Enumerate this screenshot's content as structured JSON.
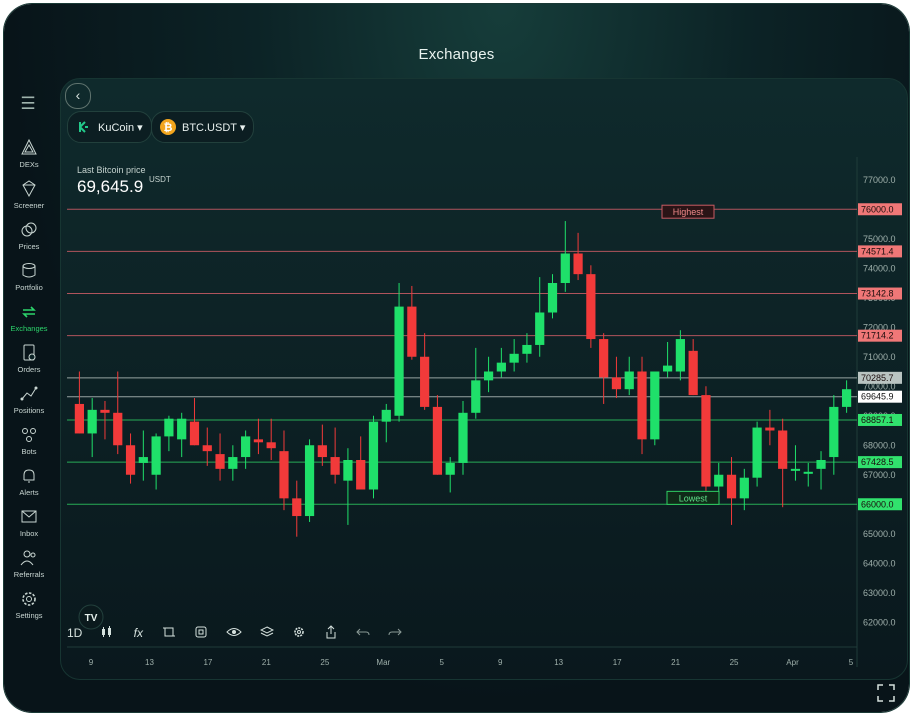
{
  "title": "Exchanges",
  "sidebar": {
    "items": [
      {
        "label": "DEXs",
        "icon": "dex-icon"
      },
      {
        "label": "Screener",
        "icon": "diamond-icon"
      },
      {
        "label": "Prices",
        "icon": "coin-icon"
      },
      {
        "label": "Portfolio",
        "icon": "portfolio-icon"
      },
      {
        "label": "Exchanges",
        "icon": "exchange-arrows-icon",
        "active": true
      },
      {
        "label": "Orders",
        "icon": "orders-icon"
      },
      {
        "label": "Positions",
        "icon": "positions-icon"
      },
      {
        "label": "Bots",
        "icon": "bots-icon"
      },
      {
        "label": "Alerts",
        "icon": "bell-icon"
      },
      {
        "label": "Inbox",
        "icon": "mail-icon"
      },
      {
        "label": "Referrals",
        "icon": "users-icon"
      },
      {
        "label": "Settings",
        "icon": "gear-icon"
      }
    ]
  },
  "selectors": {
    "exchange": "KuCoin ▾",
    "pair": "BTC.USDT ▾"
  },
  "price": {
    "label": "Last Bitcoin price",
    "value": "69,645.9",
    "unit": "USDT"
  },
  "toolbar": {
    "interval": "1D",
    "fx": "fx"
  },
  "colors": {
    "up": "#1fe06a",
    "down": "#f23a3a",
    "resistance": "#d9606a",
    "support": "#2fcf63",
    "current": "#b9c4c1"
  },
  "chart_data": {
    "type": "candlestick",
    "y_ticks": [
      62000,
      63000,
      64000,
      65000,
      66000,
      67000,
      68000,
      69000,
      70000,
      71000,
      72000,
      73000,
      74000,
      75000,
      76000,
      77000
    ],
    "ylim": [
      61500,
      77500
    ],
    "x_tick_labels": [
      "9",
      "13",
      "17",
      "21",
      "25",
      "Mar",
      "5",
      "9",
      "13",
      "17",
      "21",
      "25",
      "Apr",
      "5"
    ],
    "resistance_levels": [
      "76000.0",
      "74571.4",
      "73142.8",
      "71714.2"
    ],
    "support_levels": [
      "68857.1",
      "67428.5",
      "66000.0"
    ],
    "current_levels": [
      "70285.7",
      "69645.9"
    ],
    "annotations": {
      "highest": "Highest",
      "lowest": "Lowest"
    },
    "candles": [
      {
        "o": 69400,
        "h": 70500,
        "l": 68400,
        "c": 68400
      },
      {
        "o": 68400,
        "h": 69600,
        "l": 67600,
        "c": 69200
      },
      {
        "o": 69200,
        "h": 69500,
        "l": 68200,
        "c": 69100
      },
      {
        "o": 69100,
        "h": 70500,
        "l": 67700,
        "c": 68000
      },
      {
        "o": 68000,
        "h": 68400,
        "l": 66700,
        "c": 67000
      },
      {
        "o": 67400,
        "h": 68500,
        "l": 66800,
        "c": 67600
      },
      {
        "o": 67000,
        "h": 68400,
        "l": 66500,
        "c": 68300
      },
      {
        "o": 68300,
        "h": 69000,
        "l": 67800,
        "c": 68900
      },
      {
        "o": 68200,
        "h": 69100,
        "l": 67600,
        "c": 68900
      },
      {
        "o": 68800,
        "h": 69600,
        "l": 68000,
        "c": 68000
      },
      {
        "o": 68000,
        "h": 68600,
        "l": 67300,
        "c": 67800
      },
      {
        "o": 67700,
        "h": 68400,
        "l": 66800,
        "c": 67200
      },
      {
        "o": 67200,
        "h": 68000,
        "l": 66800,
        "c": 67600
      },
      {
        "o": 67600,
        "h": 68500,
        "l": 67200,
        "c": 68300
      },
      {
        "o": 68200,
        "h": 68900,
        "l": 67700,
        "c": 68100
      },
      {
        "o": 68100,
        "h": 68900,
        "l": 67500,
        "c": 67900
      },
      {
        "o": 67800,
        "h": 68500,
        "l": 65800,
        "c": 66200
      },
      {
        "o": 66200,
        "h": 66800,
        "l": 64900,
        "c": 65600
      },
      {
        "o": 65600,
        "h": 68200,
        "l": 65400,
        "c": 68000
      },
      {
        "o": 68000,
        "h": 68700,
        "l": 67300,
        "c": 67600
      },
      {
        "o": 67600,
        "h": 68600,
        "l": 66700,
        "c": 67000
      },
      {
        "o": 66800,
        "h": 67900,
        "l": 65300,
        "c": 67500
      },
      {
        "o": 67500,
        "h": 68300,
        "l": 66500,
        "c": 66500
      },
      {
        "o": 66500,
        "h": 69000,
        "l": 66200,
        "c": 68800
      },
      {
        "o": 68800,
        "h": 69400,
        "l": 68100,
        "c": 69200
      },
      {
        "o": 69000,
        "h": 73500,
        "l": 68800,
        "c": 72700
      },
      {
        "o": 72700,
        "h": 73400,
        "l": 70900,
        "c": 71000
      },
      {
        "o": 71000,
        "h": 71800,
        "l": 69200,
        "c": 69300
      },
      {
        "o": 69300,
        "h": 69700,
        "l": 67000,
        "c": 67000
      },
      {
        "o": 67000,
        "h": 67600,
        "l": 66400,
        "c": 67400
      },
      {
        "o": 67400,
        "h": 69500,
        "l": 67000,
        "c": 69100
      },
      {
        "o": 69100,
        "h": 71300,
        "l": 68900,
        "c": 70200
      },
      {
        "o": 70200,
        "h": 71000,
        "l": 69800,
        "c": 70500
      },
      {
        "o": 70500,
        "h": 71300,
        "l": 70300,
        "c": 70800
      },
      {
        "o": 70800,
        "h": 71600,
        "l": 70500,
        "c": 71100
      },
      {
        "o": 71100,
        "h": 71800,
        "l": 70800,
        "c": 71400
      },
      {
        "o": 71400,
        "h": 73700,
        "l": 71000,
        "c": 72500
      },
      {
        "o": 72500,
        "h": 73800,
        "l": 72300,
        "c": 73500
      },
      {
        "o": 73500,
        "h": 75600,
        "l": 73200,
        "c": 74500
      },
      {
        "o": 74500,
        "h": 75200,
        "l": 73600,
        "c": 73800
      },
      {
        "o": 73800,
        "h": 74100,
        "l": 71300,
        "c": 71600
      },
      {
        "o": 71600,
        "h": 71800,
        "l": 69400,
        "c": 70300
      },
      {
        "o": 70300,
        "h": 71000,
        "l": 69600,
        "c": 69900
      },
      {
        "o": 69900,
        "h": 71000,
        "l": 69700,
        "c": 70500
      },
      {
        "o": 70500,
        "h": 71000,
        "l": 67700,
        "c": 68200
      },
      {
        "o": 68200,
        "h": 70100,
        "l": 68000,
        "c": 70500
      },
      {
        "o": 70500,
        "h": 71500,
        "l": 70300,
        "c": 70700
      },
      {
        "o": 70500,
        "h": 71900,
        "l": 70200,
        "c": 71600
      },
      {
        "o": 71200,
        "h": 71600,
        "l": 69700,
        "c": 69700
      },
      {
        "o": 69700,
        "h": 70000,
        "l": 66300,
        "c": 66600
      },
      {
        "o": 66600,
        "h": 67400,
        "l": 66000,
        "c": 67000
      },
      {
        "o": 67000,
        "h": 67600,
        "l": 65300,
        "c": 66200
      },
      {
        "o": 66200,
        "h": 67200,
        "l": 65800,
        "c": 66900
      },
      {
        "o": 66900,
        "h": 68800,
        "l": 66600,
        "c": 68600
      },
      {
        "o": 68600,
        "h": 69200,
        "l": 68000,
        "c": 68500
      },
      {
        "o": 68500,
        "h": 68900,
        "l": 65900,
        "c": 67200
      },
      {
        "o": 67200,
        "h": 68000,
        "l": 66800,
        "c": 67200
      },
      {
        "o": 67100,
        "h": 67400,
        "l": 66600,
        "c": 67100
      },
      {
        "o": 67200,
        "h": 67800,
        "l": 66500,
        "c": 67500
      },
      {
        "o": 67600,
        "h": 69700,
        "l": 67000,
        "c": 69300
      },
      {
        "o": 69300,
        "h": 70200,
        "l": 69100,
        "c": 69900
      }
    ]
  }
}
